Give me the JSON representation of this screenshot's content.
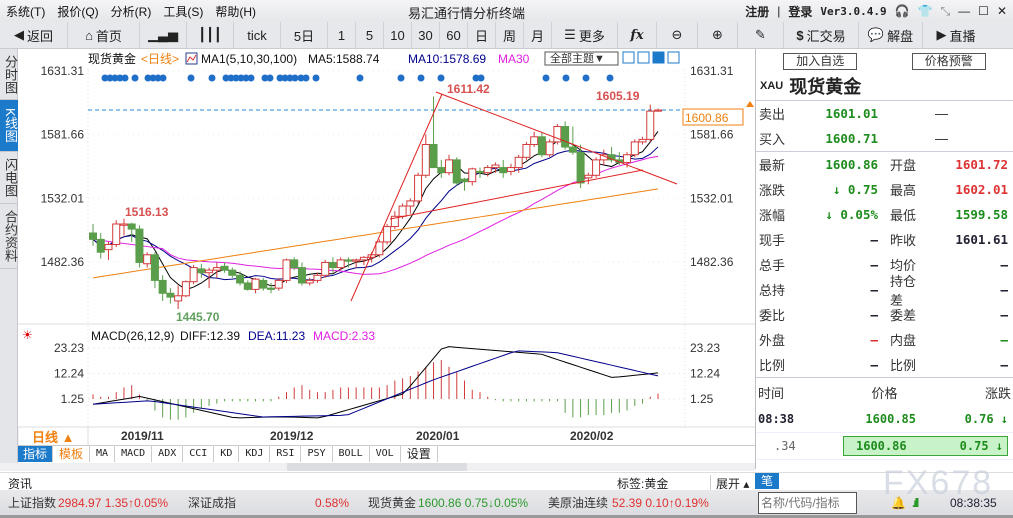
{
  "menubar": {
    "items": [
      "系统(T)",
      "报价(Q)",
      "分析(R)",
      "工具(S)",
      "帮助(H)"
    ],
    "title": "易汇通行情分析终端",
    "register": "注册",
    "login": "登录",
    "divider": "|",
    "version": "Ver3.0.4.9"
  },
  "toolbar": {
    "back": "返回",
    "home": "首页",
    "tick": "tick",
    "periods": [
      "5日",
      "1",
      "5",
      "10",
      "30",
      "60",
      "日",
      "周",
      "月"
    ],
    "more": "更多",
    "fx": "fx",
    "trade": "汇交易",
    "analysis": "解盘",
    "live": "直播"
  },
  "sidetabs": [
    "分时图",
    "K线图",
    "闪电图",
    "合约资料"
  ],
  "chart": {
    "symbol": "现货黄金",
    "period_tag": "<日线>",
    "ma_label": "MA1(5,10,30,100)",
    "ma5": "MA5:1588.74",
    "ma10": "MA10:1578.69",
    "ma30": "MA30",
    "theme_btn": "全部主题▼",
    "y_ticks": [
      "1631.31",
      "1581.66",
      "1532.01",
      "1482.36"
    ],
    "current_price": "1600.86",
    "annotations": {
      "high1": "1611.42",
      "high2": "1605.19",
      "left_high": "1516.13",
      "low": "1445.70"
    },
    "macd_label": "MACD(26,12,9)",
    "diff": "DIFF:12.39",
    "dea": "DEA:11.23",
    "macd": "MACD:2.33",
    "macd_ticks": [
      "23.23",
      "12.24",
      "1.25"
    ],
    "x_ticks": [
      "2019/11",
      "2019/12",
      "2020/01",
      "2020/02"
    ],
    "period_btn": "日线 ▲",
    "colors": {
      "up": "#d33b3b",
      "down": "#5a9e4b",
      "ma5": "#000000",
      "ma10": "#00008b",
      "ma30": "#e020e0",
      "ma100": "#f08010"
    }
  },
  "chart_data": {
    "type": "candlestick",
    "title": "现货黄金 日线",
    "ylim": [
      1430,
      1640
    ],
    "y_ticks": [
      1631.31,
      1581.66,
      1532.01,
      1482.36
    ],
    "x_ticks": [
      "2019/11",
      "2019/12",
      "2020/01",
      "2020/02"
    ],
    "marked_high": 1611.42,
    "recent_high": 1605.19,
    "marked_low": 1445.7,
    "left_high": 1516.13,
    "last": 1600.86,
    "ma": {
      "MA5": 1588.74,
      "MA10": 1578.69
    },
    "macd": {
      "DIFF": 12.39,
      "DEA": 11.23,
      "MACD": 2.33,
      "ylim": [
        -10,
        25
      ]
    }
  },
  "indicator_bar": {
    "tabs": [
      "指标",
      "模板"
    ],
    "items": [
      "MA",
      "MACD",
      "ADX",
      "CCI",
      "KD",
      "KDJ",
      "RSI",
      "PSY",
      "BOLL",
      "VOL",
      "设置"
    ]
  },
  "panel": {
    "add_watch": "加入自选",
    "alert": "价格预警",
    "code": "XAU",
    "name": "现货黄金",
    "sell_label": "卖出",
    "sell": "1601.01",
    "sell_vol": "—",
    "buy_label": "买入",
    "buy": "1600.71",
    "buy_vol": "—",
    "rows": [
      {
        "l": "最新",
        "v": "1600.86",
        "vc": "green",
        "l2": "开盘",
        "v2": "1601.72",
        "v2c": "red"
      },
      {
        "l": "涨跌",
        "v": "↓ 0.75",
        "vc": "green",
        "l2": "最高",
        "v2": "1602.01",
        "v2c": "red"
      },
      {
        "l": "涨幅",
        "v": "↓ 0.05%",
        "vc": "green",
        "l2": "最低",
        "v2": "1599.58",
        "v2c": "green"
      },
      {
        "l": "现手",
        "v": "—",
        "vc": "dark",
        "l2": "昨收",
        "v2": "1601.61",
        "v2c": "dark"
      },
      {
        "l": "总手",
        "v": "—",
        "vc": "dark",
        "l2": "均价",
        "v2": "—",
        "v2c": "dark"
      },
      {
        "l": "总持",
        "v": "—",
        "vc": "dark",
        "l2": "持仓差",
        "v2": "—",
        "v2c": "dark"
      },
      {
        "l": "委比",
        "v": "—",
        "vc": "dark",
        "l2": "委差",
        "v2": "—",
        "v2c": "dark"
      },
      {
        "l": "外盘",
        "v": "—",
        "vc": "red",
        "l2": "内盘",
        "v2": "—",
        "v2c": "green"
      },
      {
        "l": "比例",
        "v": "—",
        "vc": "dark",
        "l2": "比例",
        "v2": "—",
        "v2c": "dark"
      }
    ],
    "tick_head": {
      "time": "时间",
      "price": "价格",
      "change": "涨跌"
    },
    "ticks": [
      {
        "time": "08:38",
        "price": "1600.85",
        "change": "0.76 ↓"
      },
      {
        "time": ".34",
        "price": "1600.86",
        "change": "0.75 ↓"
      }
    ],
    "tab": "笔"
  },
  "news": {
    "label": "资讯",
    "tag": "标签:黄金",
    "expand": "展开 ▴"
  },
  "status": {
    "items": [
      {
        "name": "上证指数",
        "value": "2984.97 1.35↑0.05%",
        "color": "red"
      },
      {
        "name": "深证成指",
        "value": "0.58%",
        "color": "red"
      },
      {
        "name": "现货黄金",
        "value": "1600.86 0.75↓0.05%",
        "color": "green"
      },
      {
        "name": "美原油连续",
        "value": "52.39 0.10↑0.19%",
        "color": "red"
      }
    ],
    "search_placeholder": "名称/代码/指标",
    "watermark": "FX678",
    "clock": "08:38:35"
  }
}
